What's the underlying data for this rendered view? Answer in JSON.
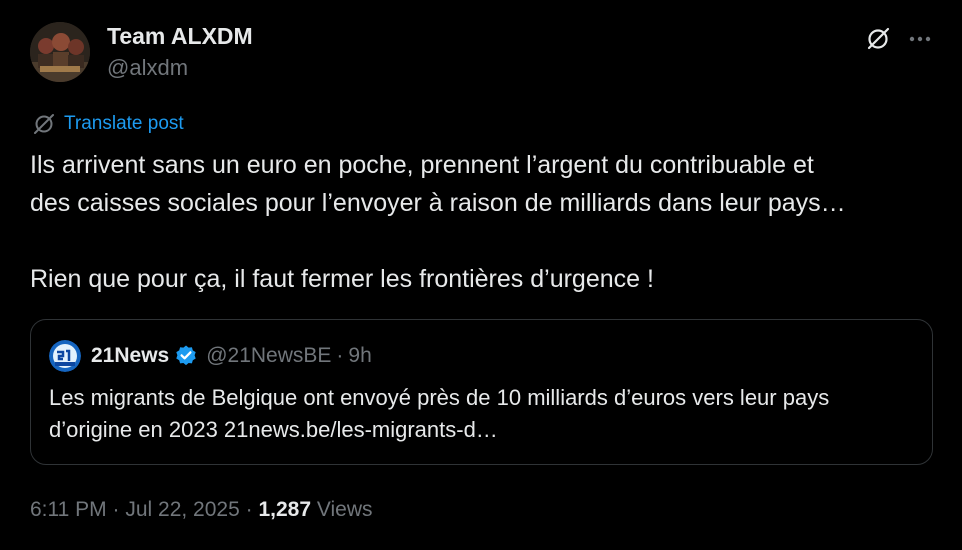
{
  "author": {
    "display_name": "Team ALXDM",
    "handle": "@alxdm",
    "avatar_icon": "avatar-image"
  },
  "header_icons": [
    "grok-icon",
    "more-icon"
  ],
  "translate": {
    "label": "Translate post",
    "icon": "translate-icon",
    "color": "#1d9bf0"
  },
  "tweet": {
    "lines": [
      "Ils arrivent sans un euro en poche, prennent l’argent du contribuable et",
      "des caisses sociales pour l’envoyer à raison de milliards dans leur pays…",
      "",
      "Rien que pour ça, il faut fermer les frontières d’urgence !"
    ]
  },
  "quote": {
    "name": "21News",
    "handle": "@21NewsBE",
    "separator": "·",
    "time": "9h",
    "verified_color": "#1d9bf0",
    "text_lines": [
      "Les migrants de Belgique ont envoyé près de 10 milliards d’euros vers leur pays",
      "d’origine en 2023 21news.be/les-migrants-d…"
    ]
  },
  "meta": {
    "time": "6:11 PM",
    "separator": "·",
    "date": "Jul 22, 2025",
    "views_count": "1,287",
    "views_label": "Views"
  },
  "colors": {
    "background": "#000000",
    "text": "#e7e9ea",
    "secondary": "#71767b",
    "border": "#2f3336",
    "accent": "#1d9bf0"
  }
}
